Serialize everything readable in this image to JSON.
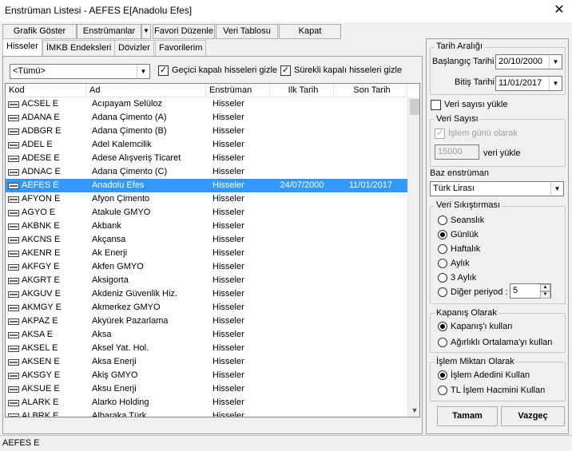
{
  "window": {
    "title": "Enstrüman Listesi - AEFES E[Anadolu Efes]",
    "close": "✕"
  },
  "toolbar": {
    "grafik": "Grafik Göster",
    "enstrumanlar": "Enstrümanlar",
    "favori": "Favori Düzenle",
    "veri": "Veri Tablosu",
    "kapat": "Kapat"
  },
  "tabs": [
    "Hisseler",
    "İMKB Endeksleri",
    "Dövizler",
    "Favorilerim"
  ],
  "filter": {
    "select": "<Tümü>",
    "gecici": "Geçici kapalı hisseleri gizle",
    "surekli": "Sürekli kapalı hisseleri gizle"
  },
  "columns": [
    "Kod",
    "Ad",
    "Enstrüman",
    "Ilk Tarih",
    "Son Tarih"
  ],
  "rows": [
    [
      "ACSEL E",
      "Acıpayam Selüloz",
      "Hisseler",
      "",
      ""
    ],
    [
      "ADANA E",
      "Adana Çimento (A)",
      "Hisseler",
      "",
      ""
    ],
    [
      "ADBGR E",
      "Adana Çimento (B)",
      "Hisseler",
      "",
      ""
    ],
    [
      "ADEL  E",
      "Adel Kalemcilik",
      "Hisseler",
      "",
      ""
    ],
    [
      "ADESE E",
      "Adese Alışveriş Ticaret",
      "Hisseler",
      "",
      ""
    ],
    [
      "ADNAC E",
      "Adana Çimento (C)",
      "Hisseler",
      "",
      ""
    ],
    [
      "AEFES E",
      "Anadolu Efes",
      "Hisseler",
      "24/07/2000",
      "11/01/2017"
    ],
    [
      "AFYON E",
      "Afyon Çimento",
      "Hisseler",
      "",
      ""
    ],
    [
      "AGYO  E",
      "Atakule GMYO",
      "Hisseler",
      "",
      ""
    ],
    [
      "AKBNK E",
      "Akbank",
      "Hisseler",
      "",
      ""
    ],
    [
      "AKCNS E",
      "Akçansa",
      "Hisseler",
      "",
      ""
    ],
    [
      "AKENR E",
      "Ak Enerji",
      "Hisseler",
      "",
      ""
    ],
    [
      "AKFGY E",
      "Akfen GMYO",
      "Hisseler",
      "",
      ""
    ],
    [
      "AKGRT E",
      "Aksigorta",
      "Hisseler",
      "",
      ""
    ],
    [
      "AKGUV E",
      "Akdeniz Güvenlik Hiz.",
      "Hisseler",
      "",
      ""
    ],
    [
      "AKMGY E",
      "Akmerkez GMYO",
      "Hisseler",
      "",
      ""
    ],
    [
      "AKPAZ E",
      "Akyürek Pazarlama",
      "Hisseler",
      "",
      ""
    ],
    [
      "AKSA  E",
      "Aksa",
      "Hisseler",
      "",
      ""
    ],
    [
      "AKSEL E",
      "Aksel Yat. Hol.",
      "Hisseler",
      "",
      ""
    ],
    [
      "AKSEN E",
      "Aksa Enerji",
      "Hisseler",
      "",
      ""
    ],
    [
      "AKSGY E",
      "Akiş GMYO",
      "Hisseler",
      "",
      ""
    ],
    [
      "AKSUE E",
      "Aksu Enerji",
      "Hisseler",
      "",
      ""
    ],
    [
      "ALARK E",
      "Alarko Holding",
      "Hisseler",
      "",
      ""
    ],
    [
      "ALBRK E",
      "Albaraka Türk",
      "Hisseler",
      "",
      ""
    ]
  ],
  "right": {
    "tarih_araligi": "Tarih Aralığı",
    "baslangic_label": "Başlangıç Tarihi",
    "baslangic": "20/10/2000",
    "bitis_label": "Bitiş Tarihi",
    "bitis": "11/01/2017",
    "veri_sayisi_yukle": "Veri sayısı yükle",
    "veri_sayisi": "Veri Sayısı",
    "islem_gunu": "İşlem günü olarak",
    "count": "15000",
    "veri_yukle": "veri yükle",
    "baz_enstruman": "Baz enstrüman",
    "baz_value": "Türk Lirası",
    "sikistirma": "Veri Sıkıştırması",
    "periods": [
      "Seanslık",
      "Günlük",
      "Haftalık",
      "Aylık",
      "3 Aylık",
      "Diğer  periyod :"
    ],
    "period_value": "5",
    "kapanis": "Kapanış Olarak",
    "kapanis_opts": [
      "Kapanış'ı kullan",
      "Ağırlıklı Ortalama'yı kullan"
    ],
    "islem_miktari": "İşlem Miktarı Olarak",
    "miktar_opts": [
      "İşlem Adedini Kullan",
      "TL İşlem Hacmini Kullan"
    ],
    "tamam": "Tamam",
    "vazgec": "Vazgeç"
  },
  "status": "AEFES E"
}
